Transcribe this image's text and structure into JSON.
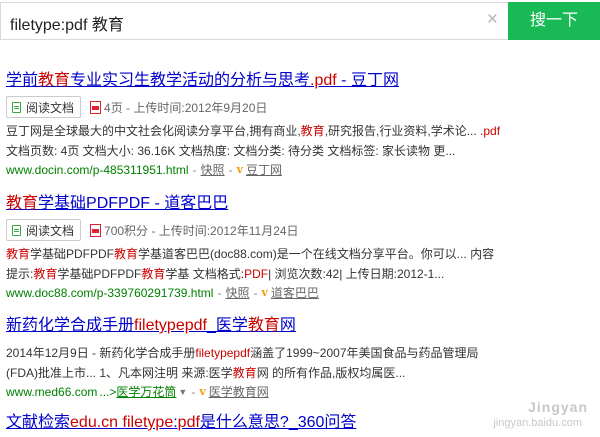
{
  "search": {
    "query": "filetype:pdf 教育",
    "button_label": "搜一下",
    "clear": "×"
  },
  "results": [
    {
      "title_parts": [
        "学前",
        "教育",
        "专业实习生教学活动的分析与思考",
        ".pdf",
        " - 豆丁网"
      ],
      "read_label": "阅读文档",
      "meta_text": "4页 - 上传时间:2012年9月20日",
      "snippet1_parts": [
        "豆丁网是全球最大的中文社会化阅读分享平台,拥有商业,",
        "教育",
        ",研究报告,行业资料,学术论... ",
        ".pdf"
      ],
      "snippet2": "文档页数: 4页 文档大小: 36.16K 文档热度: 文档分类: 待分类 文档标签: 家长读物 更...",
      "url": "www.docin.com/p-485311951.html",
      "snapshot": "快照",
      "source": "豆丁网"
    },
    {
      "title_parts": [
        "教育",
        "学基础PDFPDF - 道客巴巴"
      ],
      "read_label": "阅读文档",
      "meta_text": "700积分 - 上传时间:2012年11月24日",
      "snippet1_parts": [
        "教育",
        "学基础PDFPDF",
        "教育",
        "学基道客巴巴(doc88.com)是一个在线文档分享平台。你可以... 内容"
      ],
      "snippet2_parts": [
        "提示:",
        "教育",
        "学基础PDFPDF",
        "教育",
        "学基 文档格式:",
        "PDF",
        "| 浏览次数:42| 上传日期:2012-1..."
      ],
      "url": "www.doc88.com/p-339760291739.html",
      "snapshot": "快照",
      "source": "道客巴巴"
    },
    {
      "title_parts": [
        "新药化学合成手册",
        "filetypepdf",
        "_医学",
        "教育",
        "网"
      ],
      "snippet1_parts": [
        "2014年12月9日 - 新药化学合成手册",
        "filetypepdf",
        "涵盖了1999~2007年美国食品与药品管理局"
      ],
      "snippet2_parts": [
        "(FDA)批准上市... 1、凡本网注明 来源:医学",
        "教育",
        "网 的所有作品,版权均属医..."
      ],
      "url": "www.med66.com",
      "url_more": "...>",
      "breadcrumb": "医学万花筒",
      "source": "医学教育网"
    },
    {
      "title_parts": [
        "文献检索",
        "edu.cn",
        " ",
        "filetype",
        ":",
        "pdf",
        "是什么意思?_360问答"
      ]
    }
  ],
  "watermark": {
    "line1": "Jingyan",
    "line2": "jingyan.baidu.com"
  }
}
